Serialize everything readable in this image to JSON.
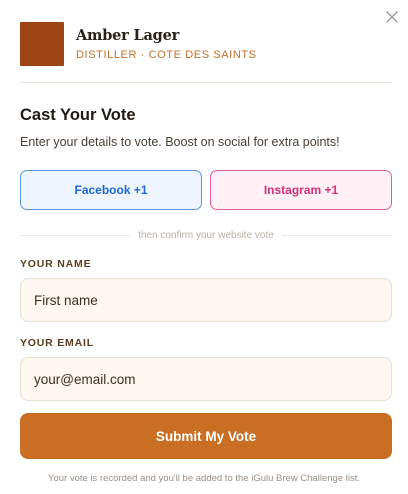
{
  "product": {
    "name": "Amber Lager",
    "meta": "DISTILLER · COTE DES SAINTS"
  },
  "vote": {
    "title": "Cast Your Vote",
    "subtitle": "Enter your details to vote. Boost on social for extra points!"
  },
  "social": {
    "facebook_label": "Facebook +1",
    "instagram_label": "Instagram +1"
  },
  "confirm_text": "then confirm your website vote",
  "form": {
    "name_label": "YOUR NAME",
    "name_placeholder": "First name",
    "email_label": "YOUR EMAIL",
    "email_placeholder": "your@email.com",
    "submit_label": "Submit My Vote"
  },
  "footnote": "Your vote is recorded and you'll be added to the iGulu Brew Challenge list.",
  "icons": {
    "close": "close-icon"
  },
  "colors": {
    "accent": "#c96e22",
    "facebook": "#1e66d4",
    "instagram": "#d2307a",
    "thumbnail": "#9c4413"
  }
}
